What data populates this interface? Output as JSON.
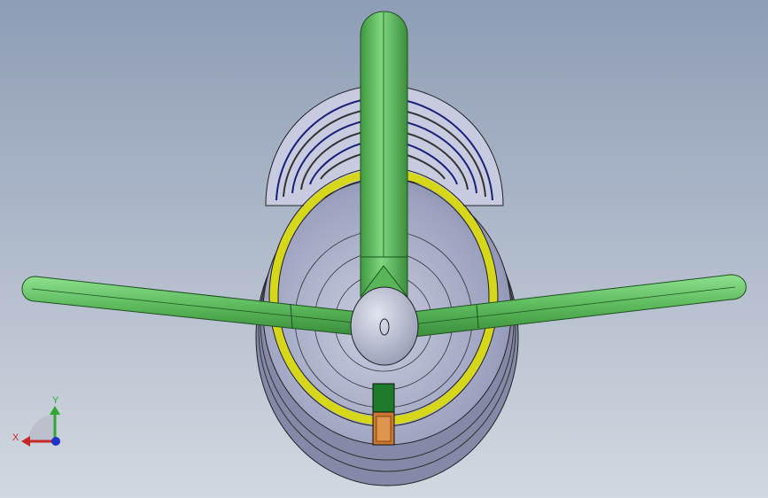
{
  "viewport": {
    "background_top": "#8e9db6",
    "background_bottom": "#d2d8e0"
  },
  "model": {
    "colors": {
      "arm_green": "#5fbf5f",
      "arm_edge": "#1f4f1f",
      "body_grey": "#8f95b0",
      "body_light": "#c3c8dc",
      "ring_yellow": "#d7d71a",
      "coil_blue": "#1a1f7a",
      "motor_green": "#1c7a2a",
      "motor_orange": "#c87832",
      "hub_grey": "#b9bdd0"
    }
  },
  "triad": {
    "x_label": "X",
    "y_label": "Y",
    "x_color": "#c62828",
    "y_color": "#2fa82f",
    "z_color": "#1f35c9"
  }
}
